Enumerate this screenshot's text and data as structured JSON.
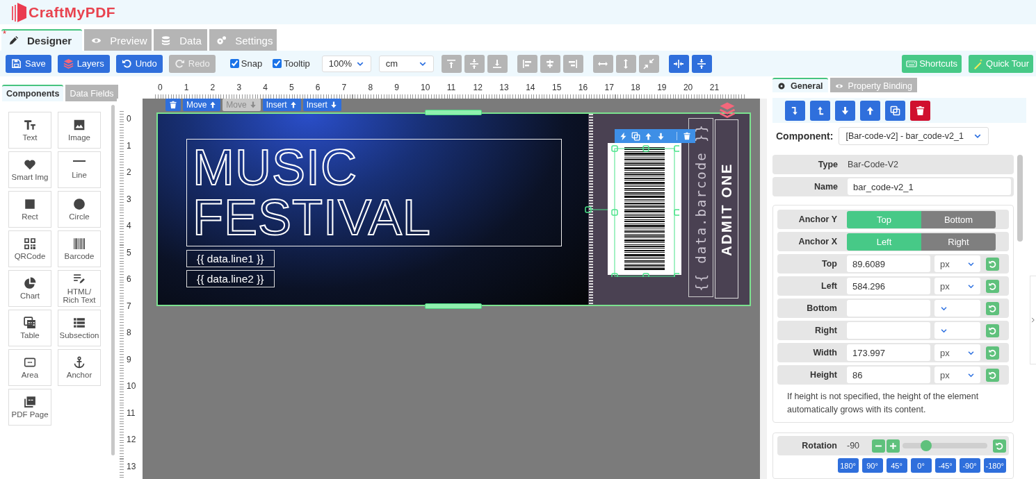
{
  "logo": "CraftMyPDF",
  "unsaved_mark": "*",
  "tabs": [
    {
      "label": "Designer",
      "selected": true,
      "unsaved": true
    },
    {
      "label": "Preview",
      "selected": false,
      "unsaved": false
    },
    {
      "label": "Data",
      "selected": false,
      "unsaved": false
    },
    {
      "label": "Settings",
      "selected": false,
      "unsaved": false
    }
  ],
  "toolbar": {
    "buttons": [
      {
        "kind": "save",
        "label": "Save",
        "disabled": false
      },
      {
        "kind": "layers",
        "label": "Layers",
        "disabled": false
      },
      {
        "kind": "undo",
        "label": "Undo",
        "disabled": false
      },
      {
        "kind": "redo",
        "label": "Redo",
        "disabled": true
      }
    ],
    "checkboxes": [
      {
        "label": "Snap",
        "checked": true
      },
      {
        "label": "Tooltip",
        "checked": true
      }
    ],
    "zoom": "100%",
    "unit": "cm",
    "icon_buttons": [
      {
        "kind": "align-top",
        "active": false
      },
      {
        "kind": "align-middle",
        "active": false
      },
      {
        "kind": "align-bottom",
        "active": false
      },
      {
        "kind": "align-left",
        "active": false
      },
      {
        "kind": "align-center",
        "active": false
      },
      {
        "kind": "align-right",
        "active": false
      },
      {
        "kind": "same-width",
        "active": false
      },
      {
        "kind": "same-height",
        "active": false
      },
      {
        "kind": "shrink",
        "active": false
      },
      {
        "kind": "center-horizontal",
        "active": true
      },
      {
        "kind": "center-vertical",
        "active": true
      }
    ],
    "right_buttons": [
      {
        "kind": "shortcuts",
        "label": "Shortcuts"
      },
      {
        "kind": "tour",
        "label": "Quick Tour"
      }
    ]
  },
  "left_panel": {
    "tabs": [
      {
        "label": "Components",
        "selected": true
      },
      {
        "label": "Data Fields",
        "selected": false
      }
    ],
    "components": [
      {
        "kind": "text",
        "label": "Text"
      },
      {
        "kind": "image",
        "label": "Image"
      },
      {
        "kind": "smart-image",
        "label": "Smart Img"
      },
      {
        "kind": "line",
        "label": "Line"
      },
      {
        "kind": "rect",
        "label": "Rect"
      },
      {
        "kind": "circle",
        "label": "Circle"
      },
      {
        "kind": "qrcode",
        "label": "QRCode"
      },
      {
        "kind": "barcode",
        "label": "Barcode"
      },
      {
        "kind": "chart",
        "label": "Chart"
      },
      {
        "kind": "richtext",
        "label": "HTML/ Rich Text"
      },
      {
        "kind": "table",
        "label": "Table"
      },
      {
        "kind": "subsection",
        "label": "Subsection"
      },
      {
        "kind": "area",
        "label": "Area"
      },
      {
        "kind": "anchor",
        "label": "Anchor"
      },
      {
        "kind": "pdf",
        "label": "PDF Page"
      }
    ]
  },
  "ruler": {
    "horizontal": [
      "0",
      "1",
      "2",
      "3",
      "4",
      "5",
      "6",
      "7",
      "8",
      "9",
      "10",
      "11",
      "12",
      "13",
      "14",
      "15",
      "16",
      "17",
      "18",
      "19",
      "20",
      "21"
    ],
    "vertical": [
      "0",
      "1",
      "2",
      "3",
      "4",
      "5",
      "6",
      "7",
      "8",
      "9",
      "10",
      "11",
      "12",
      "13"
    ]
  },
  "canvas": {
    "element_toolbar": [
      {
        "kind": "delete",
        "disabled": false
      },
      {
        "kind": "up",
        "label": "Move",
        "disabled": false
      },
      {
        "kind": "down",
        "label": "Move",
        "disabled": true
      },
      {
        "kind": "up",
        "label": "Insert",
        "disabled": false
      },
      {
        "kind": "down",
        "label": "Insert",
        "disabled": false
      }
    ],
    "ticket": {
      "title_lines": [
        "MUSIC",
        "FESTIVAL"
      ],
      "fields": [
        "{{ data.line1 }}",
        "{{ data.line2 }}"
      ],
      "barcode_text": "{{ data.barcode }}",
      "admit": "ADMIT ONE"
    }
  },
  "right_panel": {
    "tabs": [
      {
        "label": "General",
        "selected": true
      },
      {
        "label": "Property Binding",
        "selected": false
      }
    ],
    "actions": [
      {
        "kind": "send-to-back"
      },
      {
        "kind": "bring-to-front"
      },
      {
        "kind": "move-down"
      },
      {
        "kind": "move-up"
      },
      {
        "kind": "duplicate"
      },
      {
        "kind": "delete"
      }
    ],
    "component_label": "Component:",
    "component": "[Bar-code-v2] - bar_code-v2_1",
    "type": {
      "label": "Type",
      "value": "Bar-Code-V2"
    },
    "name": {
      "label": "Name",
      "value": "bar_code-v2_1"
    },
    "anchors": [
      {
        "label": "Anchor Y",
        "options": [
          {
            "label": "Top",
            "selected": true
          },
          {
            "label": "Bottom",
            "selected": false
          }
        ]
      },
      {
        "label": "Anchor X",
        "options": [
          {
            "label": "Left",
            "selected": true
          },
          {
            "label": "Right",
            "selected": false
          }
        ]
      }
    ],
    "fields": [
      {
        "label": "Top",
        "value": "89.6089",
        "unit": "px"
      },
      {
        "label": "Left",
        "value": "584.296",
        "unit": "px"
      },
      {
        "label": "Bottom"
      },
      {
        "label": "Right"
      },
      {
        "label": "Width",
        "value": "173.997",
        "unit": "px"
      },
      {
        "label": "Height",
        "value": "86",
        "unit": "px"
      }
    ],
    "note": "If height is not specified, the height of the element automatically grows with its content.",
    "rotation": {
      "label": "Rotation",
      "value": "-90",
      "level": 0.28,
      "presets": [
        "180°",
        "90°",
        "45°",
        "0°",
        "-45°",
        "-90°",
        "-180°"
      ]
    }
  }
}
